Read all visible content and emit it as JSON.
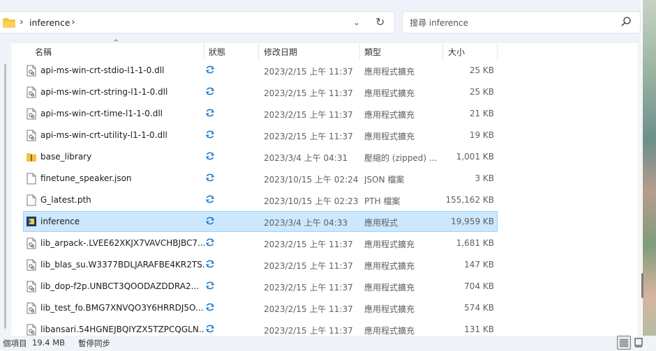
{
  "address_bar": {
    "crumb": "inference",
    "icons": [
      "folder-icon",
      "chevron-right-icon",
      "chevron-down-icon",
      "refresh-icon"
    ]
  },
  "search": {
    "placeholder": "搜尋 inference",
    "value": ""
  },
  "columns": {
    "name": "名稱",
    "status": "狀態",
    "modified": "修改日期",
    "type": "類型",
    "size": "大小"
  },
  "files": [
    {
      "name": "api-ms-win-crt-stdio-l1-1-0.dll",
      "date": "2023/2/15 上午 11:37",
      "type": "應用程式擴充",
      "size": "25 KB",
      "icon": "dll"
    },
    {
      "name": "api-ms-win-crt-string-l1-1-0.dll",
      "date": "2023/2/15 上午 11:37",
      "type": "應用程式擴充",
      "size": "25 KB",
      "icon": "dll"
    },
    {
      "name": "api-ms-win-crt-time-l1-1-0.dll",
      "date": "2023/2/15 上午 11:37",
      "type": "應用程式擴充",
      "size": "21 KB",
      "icon": "dll"
    },
    {
      "name": "api-ms-win-crt-utility-l1-1-0.dll",
      "date": "2023/2/15 上午 11:37",
      "type": "應用程式擴充",
      "size": "19 KB",
      "icon": "dll"
    },
    {
      "name": "base_library",
      "date": "2023/3/4 上午 04:31",
      "type": "壓縮的 (zipped) ...",
      "size": "1,001 KB",
      "icon": "zip"
    },
    {
      "name": "finetune_speaker.json",
      "date": "2023/10/15 上午 02:24",
      "type": "JSON 檔案",
      "size": "3 KB",
      "icon": "file"
    },
    {
      "name": "G_latest.pth",
      "date": "2023/10/15 上午 02:23",
      "type": "PTH 檔案",
      "size": "155,162 KB",
      "icon": "file"
    },
    {
      "name": "inference",
      "date": "2023/3/4 上午 04:33",
      "type": "應用程式",
      "size": "19,959 KB",
      "icon": "exe"
    },
    {
      "name": "lib_arpack-.LVEE62XKJX7VAVCHBJBC7...",
      "date": "2023/2/15 上午 11:37",
      "type": "應用程式擴充",
      "size": "1,681 KB",
      "icon": "dll"
    },
    {
      "name": "lib_blas_su.W3377BDLJARAFBE4KR2TS...",
      "date": "2023/2/15 上午 11:37",
      "type": "應用程式擴充",
      "size": "147 KB",
      "icon": "dll"
    },
    {
      "name": "lib_dop-f2p.UNBCT3QOODAZDDRA2...",
      "date": "2023/2/15 上午 11:37",
      "type": "應用程式擴充",
      "size": "704 KB",
      "icon": "dll"
    },
    {
      "name": "lib_test_fo.BMG7XNVQO3Y6HRRDJ5O...",
      "date": "2023/2/15 上午 11:37",
      "type": "應用程式擴充",
      "size": "574 KB",
      "icon": "dll"
    },
    {
      "name": "libansari.54HGNEJBQIYZX5TZPCQGLN...",
      "date": "2023/2/15 上午 11:37",
      "type": "應用程式擴充",
      "size": "131 KB",
      "icon": "dll"
    }
  ],
  "selected_file": "inference",
  "status": {
    "count": "個項目",
    "size": "19.4 MB",
    "sync": "暫停同步"
  },
  "colors": {
    "selection_bg": "#cce8ff",
    "selection_border": "#99d1ff",
    "sync_icon": "#1a73c9",
    "folder": "#f4c342"
  }
}
